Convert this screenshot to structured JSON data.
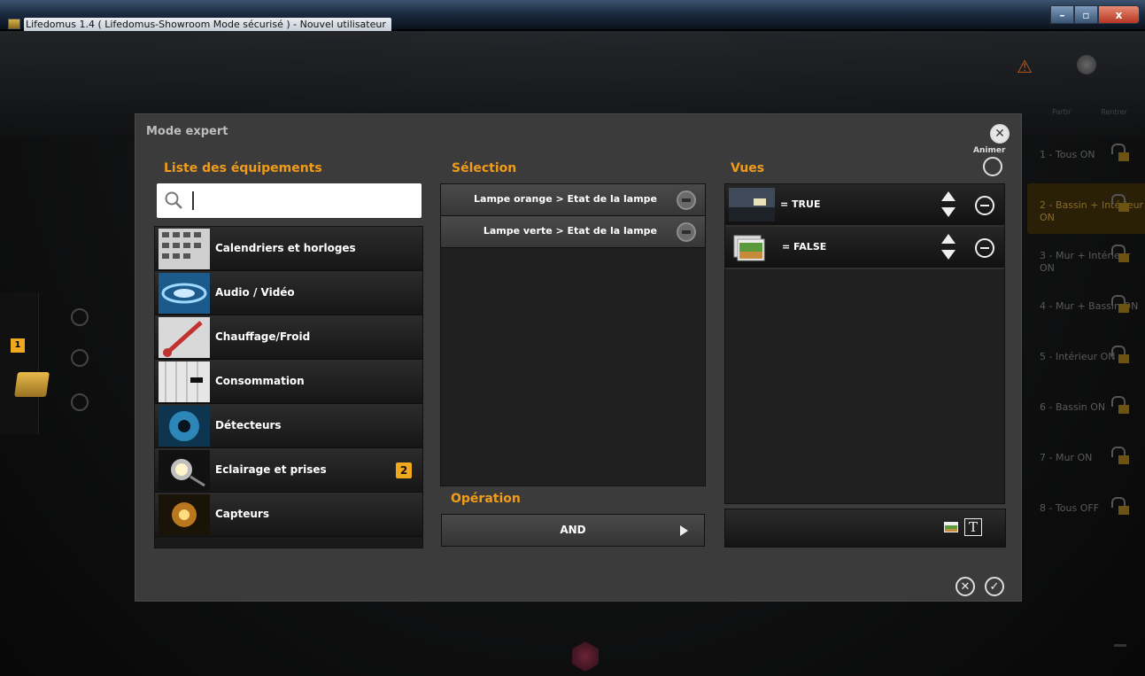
{
  "window": {
    "title": "Lifedomus 1.4 ( Lifedomus-Showroom Mode sécurisé ) - Nouvel utilisateur",
    "minimize_glyph": "–",
    "maximize_glyph": "▫",
    "close_glyph": "x"
  },
  "background": {
    "dock_badge": "1",
    "columns": [
      "Partir",
      "Rentrer"
    ],
    "scenes": [
      {
        "label": "1 - Tous ON",
        "active": false
      },
      {
        "label": "2 - Bassin + Intérieur ON",
        "active": true
      },
      {
        "label": "3 - Mur + Intérieur ON",
        "active": false
      },
      {
        "label": "4 - Mur + Bassin ON",
        "active": false
      },
      {
        "label": "5 - Intérieur ON",
        "active": false
      },
      {
        "label": "6 - Bassin ON",
        "active": false
      },
      {
        "label": "7 - Mur ON",
        "active": false
      },
      {
        "label": "8 - Tous OFF",
        "active": false
      }
    ]
  },
  "modal": {
    "title": "Mode expert",
    "animer_label": "Animer",
    "equipment": {
      "heading": "Liste des équipements",
      "search_value": "",
      "items": [
        {
          "label": "Calendriers et horloges",
          "icon": "calendar-icon"
        },
        {
          "label": "Audio / Vidéo",
          "icon": "audio-video-icon"
        },
        {
          "label": "Chauffage/Froid",
          "icon": "thermometer-icon"
        },
        {
          "label": "Consommation",
          "icon": "meter-icon"
        },
        {
          "label": "Détecteurs",
          "icon": "eye-icon"
        },
        {
          "label": "Eclairage et prises",
          "icon": "spotlight-icon",
          "badge": "2"
        },
        {
          "label": "Capteurs",
          "icon": "sensor-icon"
        }
      ]
    },
    "selection": {
      "heading": "Sélection",
      "items": [
        {
          "label": "Lampe orange > Etat de la lampe"
        },
        {
          "label": "Lampe verte > Etat de la lampe"
        }
      ]
    },
    "operation": {
      "heading": "Opération",
      "value": "AND"
    },
    "views": {
      "heading": "Vues",
      "items": [
        {
          "label": "= TRUE",
          "icon": "room-image-icon"
        },
        {
          "label": "= FALSE",
          "icon": "image-stack-icon"
        }
      ],
      "text_tool": "T"
    },
    "colors": {
      "accent": "#f09c1a",
      "badge": "#f0a81c",
      "modal_bg": "#3b3b3b"
    }
  }
}
